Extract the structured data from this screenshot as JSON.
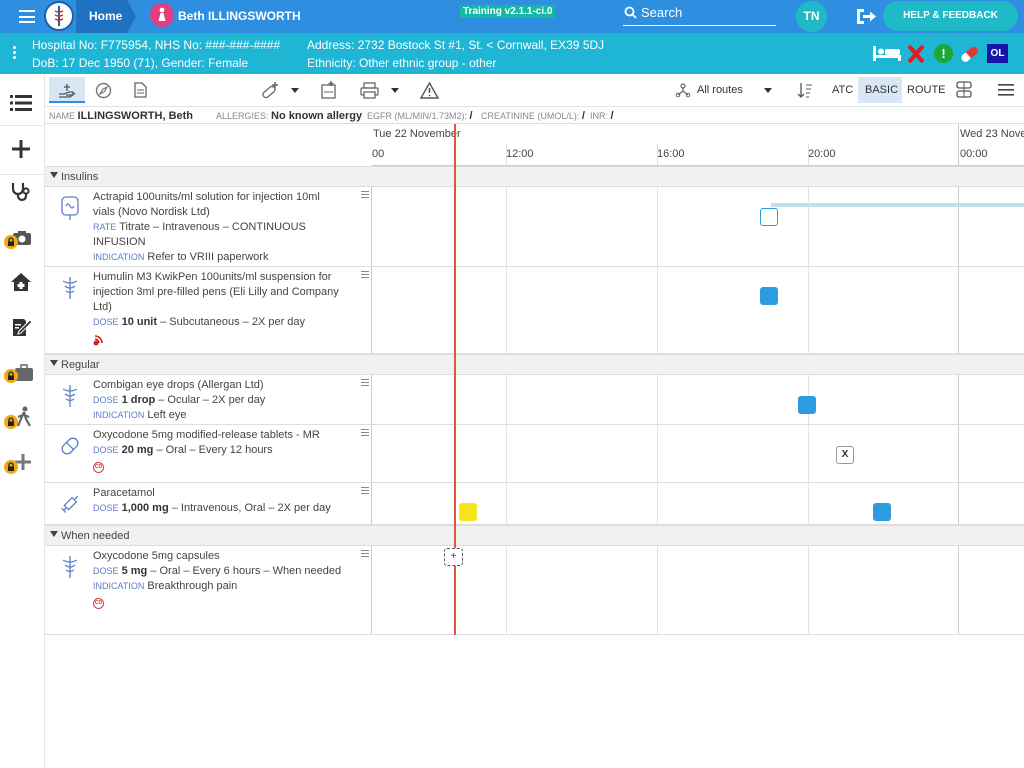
{
  "app": {
    "home_label": "Home",
    "patient_name_header": "Beth ILLINGSWORTH",
    "training_label": "Training v2.1.1-ci.0",
    "search_label": "Search",
    "user_initials": "TN",
    "help_label": "HELP & FEEDBACK"
  },
  "patient": {
    "hospital_line": "Hospital No: F775954, NHS No: ###-###-####",
    "address_line": "Address: 2732 Bostock St #1, St. < Cornwall, EX39 5DJ",
    "dob_line": "DoB: 17 Dec 1950 (71), Gender: Female",
    "ethnicity_line": "Ethnicity: Other ethnic group - other",
    "ol_badge": "OL"
  },
  "toolbar": {
    "routes_label": "All routes",
    "atc_label": "ATC",
    "basic_label": "BASIC",
    "route_label": "ROUTE"
  },
  "info": {
    "name_key": "NAME",
    "name_val": "ILLINGSWORTH, Beth",
    "allergies_key": "ALLERGIES:",
    "allergies_val": "No known allergy",
    "egfr_key": "EGFR (ML/MIN/1.73M2):",
    "egfr_val": "/",
    "creat_key": "CREATININE (UMOL/L):",
    "creat_val": "/",
    "inr_key": "INR:",
    "inr_val": "/"
  },
  "timeline": {
    "day1": "Tue 22 November",
    "day2": "Wed 23 Nove",
    "t0": "00",
    "t1": "12:00",
    "t2": "16:00",
    "t3": "20:00",
    "t4": "00:00"
  },
  "sections": {
    "insulins": "Insulins",
    "regular": "Regular",
    "when_needed": "When needed"
  },
  "drugs": {
    "actrapid": {
      "name": "Actrapid 100units/ml solution for injection 10ml vials (Novo Nordisk Ltd)",
      "k1": "RATE",
      "v1": "Titrate – Intravenous – CONTINUOUS INFUSION",
      "k2": "INDICATION",
      "v2": "Refer to VRIII paperwork"
    },
    "humulin": {
      "name": "Humulin M3 KwikPen 100units/ml suspension for injection 3ml pre-filled pens (Eli Lilly and Company Ltd)",
      "k1": "DOSE",
      "b1": "10 unit",
      "v1": " – Subcutaneous – 2X per day"
    },
    "combigan": {
      "name": "Combigan eye drops (Allergan Ltd)",
      "k1": "DOSE",
      "b1": "1 drop",
      "v1": " – Ocular – 2X per day",
      "k2": "INDICATION",
      "v2": "Left eye"
    },
    "oxy_mr": {
      "name": "Oxycodone 5mg modified-release tablets - MR",
      "k1": "DOSE",
      "b1": "20 mg",
      "v1": " – Oral – Every 12 hours",
      "cd": "CD",
      "missed": "X"
    },
    "paracetamol": {
      "name": "Paracetamol",
      "k1": "DOSE",
      "b1": "1,000 mg",
      "v1": " – Intravenous, Oral – 2X per day"
    },
    "oxy_caps": {
      "name": "Oxycodone 5mg capsules",
      "k1": "DOSE",
      "b1": "5 mg",
      "v1": " – Oral – Every 6 hours – When needed",
      "k2": "INDICATION",
      "v2": "Breakthrough pain",
      "cd": "CD",
      "add": "+"
    }
  },
  "colors": {
    "top": "#2e8fe0",
    "patient_bar": "#1fb6d6",
    "dose": "#2d9be0",
    "now_line": "#e0553b",
    "paracetamol_given": "#f6e51a"
  }
}
